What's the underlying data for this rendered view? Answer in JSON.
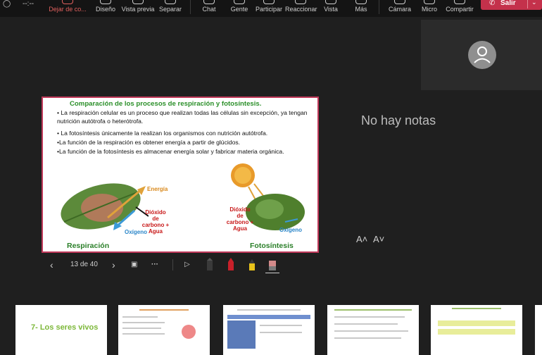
{
  "toolbar": {
    "items": [
      {
        "label": "Dejar de co...",
        "active": true
      },
      {
        "label": "Diseño"
      },
      {
        "label": "Vista previa"
      },
      {
        "label": "Separar"
      },
      {
        "label": "Chat"
      },
      {
        "label": "Gente"
      },
      {
        "label": "Participar"
      },
      {
        "label": "Reaccionar"
      },
      {
        "label": "Vista"
      },
      {
        "label": "Más"
      },
      {
        "label": "Cámara"
      },
      {
        "label": "Micro"
      },
      {
        "label": "Compartir"
      }
    ],
    "leave_label": "Salir",
    "timer_text": "--:--"
  },
  "slide": {
    "title": "Comparación de los procesos de respiración y fotosíntesis.",
    "bullets": [
      "• La respiración celular es un proceso que realizan todas las células sin excepción, ya tengan nutrición autótrofa o heterótrofa.",
      "• La fotosíntesis únicamente la realizan los organismos con nutrición autótrofa.",
      "•La función de la respiración es obtener energía a partir de glúcidos.",
      "•La función de la fotosíntesis es almacenar energía solar y fabricar materia orgánica."
    ],
    "labels": {
      "respiracion": "Respiración",
      "fotosintesis": "Fotosíntesis",
      "energia": "Energía",
      "oxigeno": "Oxígeno",
      "co2_water": "Dióxido de carbono + Agua"
    }
  },
  "controls": {
    "page_counter": "13 de 40",
    "more": "···"
  },
  "right_panel": {
    "notes_text": "No hay notas",
    "font_increase": "A˄",
    "font_decrease": "A˅"
  },
  "thumbnails": {
    "thumb1_title": "7- Los seres vivos"
  },
  "colors": {
    "accent_red": "#c4314b",
    "slide_border": "#c0395a",
    "slide_green": "#2a8f28"
  }
}
